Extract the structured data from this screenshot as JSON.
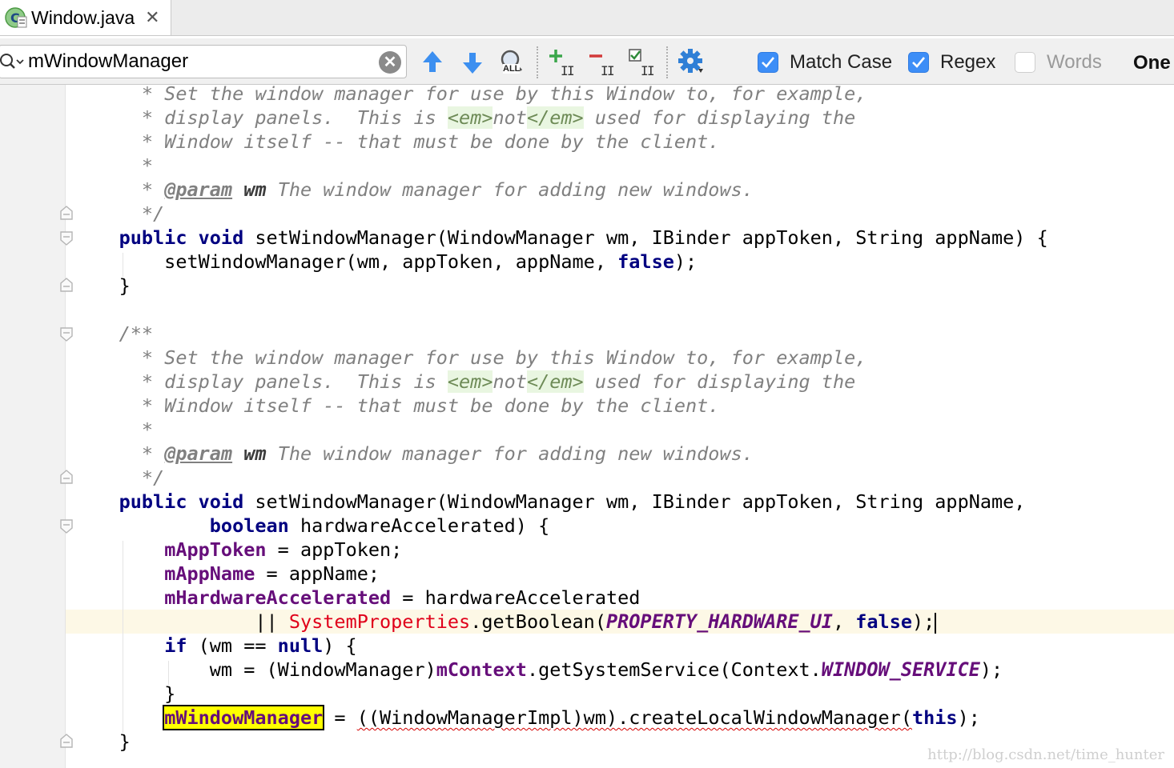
{
  "tab": {
    "title": "Window.java",
    "close_glyph": "✕",
    "icon": "java-class-icon"
  },
  "findbar": {
    "search_value": "mWindowManager",
    "clear_glyph": "✕",
    "buttons": [
      "previous-occurrence",
      "next-occurrence",
      "find-all",
      "add-occurrence",
      "remove-occurrence",
      "select-all-occurrences",
      "settings"
    ],
    "all_label": "ALL",
    "options": [
      {
        "label": "Match Case",
        "checked": true
      },
      {
        "label": "Regex",
        "checked": true
      },
      {
        "label": "Words",
        "checked": false
      }
    ],
    "one_label": "One"
  },
  "code_lines": [
    [
      {
        "c": "cm",
        "t": "      * Set the window manager for use by this Window to, for example,"
      }
    ],
    [
      {
        "c": "cm",
        "t": "      * display panels.  This is "
      },
      {
        "c": "tag",
        "t": "<em>"
      },
      {
        "c": "cm",
        "t": "not"
      },
      {
        "c": "tag",
        "t": "</em>"
      },
      {
        "c": "cm",
        "t": " used for displaying the"
      }
    ],
    [
      {
        "c": "cm",
        "t": "      * Window itself -- that must be done by the client."
      }
    ],
    [
      {
        "c": "cm",
        "t": "      *"
      }
    ],
    [
      {
        "c": "cm",
        "t": "      * "
      },
      {
        "c": "doc-tag",
        "t": "@param"
      },
      {
        "c": "cm",
        "t": " "
      },
      {
        "c": "doc-arg",
        "t": "wm"
      },
      {
        "c": "cm",
        "t": " The window manager for adding new windows."
      }
    ],
    [
      {
        "c": "cm",
        "t": "      */"
      }
    ],
    [
      {
        "c": "",
        "t": "    "
      },
      {
        "c": "kw",
        "t": "public"
      },
      {
        "c": "",
        "t": " "
      },
      {
        "c": "kw",
        "t": "void"
      },
      {
        "c": "",
        "t": " setWindowManager(WindowManager wm, IBinder appToken, String appName) {"
      }
    ],
    [
      {
        "c": "",
        "t": "        setWindowManager(wm, appToken, appName, "
      },
      {
        "c": "kw",
        "t": "false"
      },
      {
        "c": "",
        "t": ");"
      }
    ],
    [
      {
        "c": "",
        "t": "    }"
      }
    ],
    [
      {
        "c": "",
        "t": ""
      }
    ],
    [
      {
        "c": "cm",
        "t": "    /**"
      }
    ],
    [
      {
        "c": "cm",
        "t": "      * Set the window manager for use by this Window to, for example,"
      }
    ],
    [
      {
        "c": "cm",
        "t": "      * display panels.  This is "
      },
      {
        "c": "tag",
        "t": "<em>"
      },
      {
        "c": "cm",
        "t": "not"
      },
      {
        "c": "tag",
        "t": "</em>"
      },
      {
        "c": "cm",
        "t": " used for displaying the"
      }
    ],
    [
      {
        "c": "cm",
        "t": "      * Window itself -- that must be done by the client."
      }
    ],
    [
      {
        "c": "cm",
        "t": "      *"
      }
    ],
    [
      {
        "c": "cm",
        "t": "      * "
      },
      {
        "c": "doc-tag",
        "t": "@param"
      },
      {
        "c": "cm",
        "t": " "
      },
      {
        "c": "doc-arg",
        "t": "wm"
      },
      {
        "c": "cm",
        "t": " The window manager for adding new windows."
      }
    ],
    [
      {
        "c": "cm",
        "t": "      */"
      }
    ],
    [
      {
        "c": "",
        "t": "    "
      },
      {
        "c": "kw",
        "t": "public"
      },
      {
        "c": "",
        "t": " "
      },
      {
        "c": "kw",
        "t": "void"
      },
      {
        "c": "",
        "t": " setWindowManager(WindowManager wm, IBinder appToken, String appName,"
      }
    ],
    [
      {
        "c": "",
        "t": "            "
      },
      {
        "c": "kw",
        "t": "boolean"
      },
      {
        "c": "",
        "t": " hardwareAccelerated) {"
      }
    ],
    [
      {
        "c": "",
        "t": "        "
      },
      {
        "c": "fld",
        "t": "mAppToken"
      },
      {
        "c": "",
        "t": " = appToken;"
      }
    ],
    [
      {
        "c": "",
        "t": "        "
      },
      {
        "c": "fld",
        "t": "mAppName"
      },
      {
        "c": "",
        "t": " = appName;"
      }
    ],
    [
      {
        "c": "",
        "t": "        "
      },
      {
        "c": "fld",
        "t": "mHardwareAccelerated"
      },
      {
        "c": "",
        "t": " = hardwareAccelerated"
      }
    ],
    [
      {
        "c": "",
        "t": "                || "
      },
      {
        "c": "cls-red",
        "t": "SystemProperties"
      },
      {
        "c": "",
        "t": ".getBoolean("
      },
      {
        "c": "cst",
        "t": "PROPERTY_HARDWARE_UI"
      },
      {
        "c": "",
        "t": ", "
      },
      {
        "c": "kw",
        "t": "false"
      },
      {
        "c": "",
        "t": ");"
      },
      {
        "c": "cursor",
        "t": ""
      }
    ],
    [
      {
        "c": "",
        "t": "        "
      },
      {
        "c": "kw",
        "t": "if"
      },
      {
        "c": "",
        "t": " (wm == "
      },
      {
        "c": "kw",
        "t": "null"
      },
      {
        "c": "",
        "t": ") {"
      }
    ],
    [
      {
        "c": "",
        "t": "            wm = (WindowManager)"
      },
      {
        "c": "fld",
        "t": "mContext"
      },
      {
        "c": "",
        "t": ".getSystemService(Context."
      },
      {
        "c": "cst",
        "t": "WINDOW_SERVICE"
      },
      {
        "c": "",
        "t": ");"
      }
    ],
    [
      {
        "c": "",
        "t": "        }"
      }
    ],
    [
      {
        "c": "",
        "t": "        "
      },
      {
        "c": "hl",
        "t": "mWindowManager"
      },
      {
        "c": "",
        "t": " = "
      },
      {
        "c": "squig",
        "t": "((WindowManagerImpl)wm).createLocalWindowManager("
      },
      {
        "c": "kw",
        "t": "this"
      },
      {
        "c": "",
        "t": ");"
      }
    ],
    [
      {
        "c": "",
        "t": "    }"
      }
    ]
  ],
  "watermark": "http://blog.csdn.net/time_hunter"
}
